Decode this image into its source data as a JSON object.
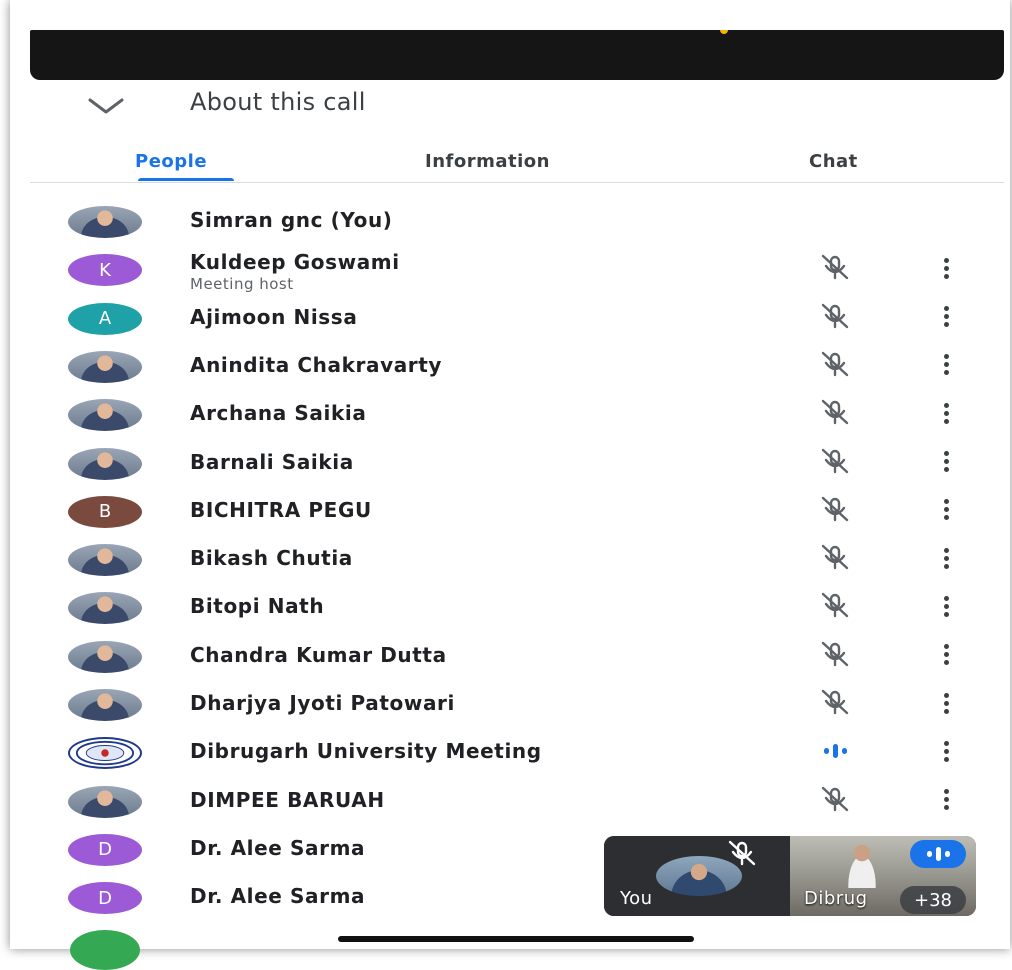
{
  "header": {
    "title": "About this call"
  },
  "tabs": [
    {
      "label": "People",
      "active": true
    },
    {
      "label": "Information",
      "active": false
    },
    {
      "label": "Chat",
      "active": false
    }
  ],
  "participants": [
    {
      "name": "Simran gnc (You)",
      "subtitle": "",
      "avatar_type": "photo",
      "avatar_color": "#7a8ea5",
      "status": "none"
    },
    {
      "name": "Kuldeep Goswami",
      "subtitle": "Meeting host",
      "avatar_type": "initial",
      "initial": "K",
      "avatar_color": "#9c5ad6",
      "status": "muted"
    },
    {
      "name": "Ajimoon Nissa",
      "subtitle": "",
      "avatar_type": "initial",
      "initial": "A",
      "avatar_color": "#1fa1a8",
      "status": "muted"
    },
    {
      "name": "Anindita Chakravarty",
      "subtitle": "",
      "avatar_type": "photo",
      "avatar_color": "#4a5a7a",
      "status": "muted"
    },
    {
      "name": "Archana Saikia",
      "subtitle": "",
      "avatar_type": "photo",
      "avatar_color": "#a56a5c",
      "status": "muted"
    },
    {
      "name": "Barnali Saikia",
      "subtitle": "",
      "avatar_type": "photo",
      "avatar_color": "#b8aaa0",
      "status": "muted"
    },
    {
      "name": "BICHITRA PEGU",
      "subtitle": "",
      "avatar_type": "initial",
      "initial": "B",
      "avatar_color": "#7b4a3e",
      "status": "muted"
    },
    {
      "name": "Bikash Chutia",
      "subtitle": "",
      "avatar_type": "photo",
      "avatar_color": "#5b8fd0",
      "status": "muted"
    },
    {
      "name": "Bitopi Nath",
      "subtitle": "",
      "avatar_type": "photo",
      "avatar_color": "#8a7a62",
      "status": "muted"
    },
    {
      "name": "Chandra Kumar Dutta",
      "subtitle": "",
      "avatar_type": "photo",
      "avatar_color": "#5a6e8a",
      "status": "muted"
    },
    {
      "name": "Dharjya Jyoti Patowari",
      "subtitle": "",
      "avatar_type": "photo",
      "avatar_color": "#b2a58c",
      "status": "muted"
    },
    {
      "name": "Dibrugarh University Meeting",
      "subtitle": "",
      "avatar_type": "logo",
      "avatar_color": "#ffffff",
      "status": "speaking"
    },
    {
      "name": "DIMPEE BARUAH",
      "subtitle": "",
      "avatar_type": "photo",
      "avatar_color": "#7b6d5a",
      "status": "muted"
    },
    {
      "name": "Dr. Alee Sarma",
      "subtitle": "",
      "avatar_type": "initial",
      "initial": "D",
      "avatar_color": "#9c5ad6",
      "status": "none"
    },
    {
      "name": "Dr. Alee Sarma",
      "subtitle": "",
      "avatar_type": "initial",
      "initial": "D",
      "avatar_color": "#9c5ad6",
      "status": "none"
    }
  ],
  "pip": {
    "self_label": "You",
    "other_label": "Dibrug",
    "more_count": "+38"
  },
  "colors": {
    "accent": "#1a73e8",
    "muted_icon": "#5f6368"
  },
  "icons": {
    "collapse": "chevron-down-icon",
    "muted": "mic-off-icon",
    "menu": "more-vert-icon",
    "speaking": "audio-level-icon"
  }
}
